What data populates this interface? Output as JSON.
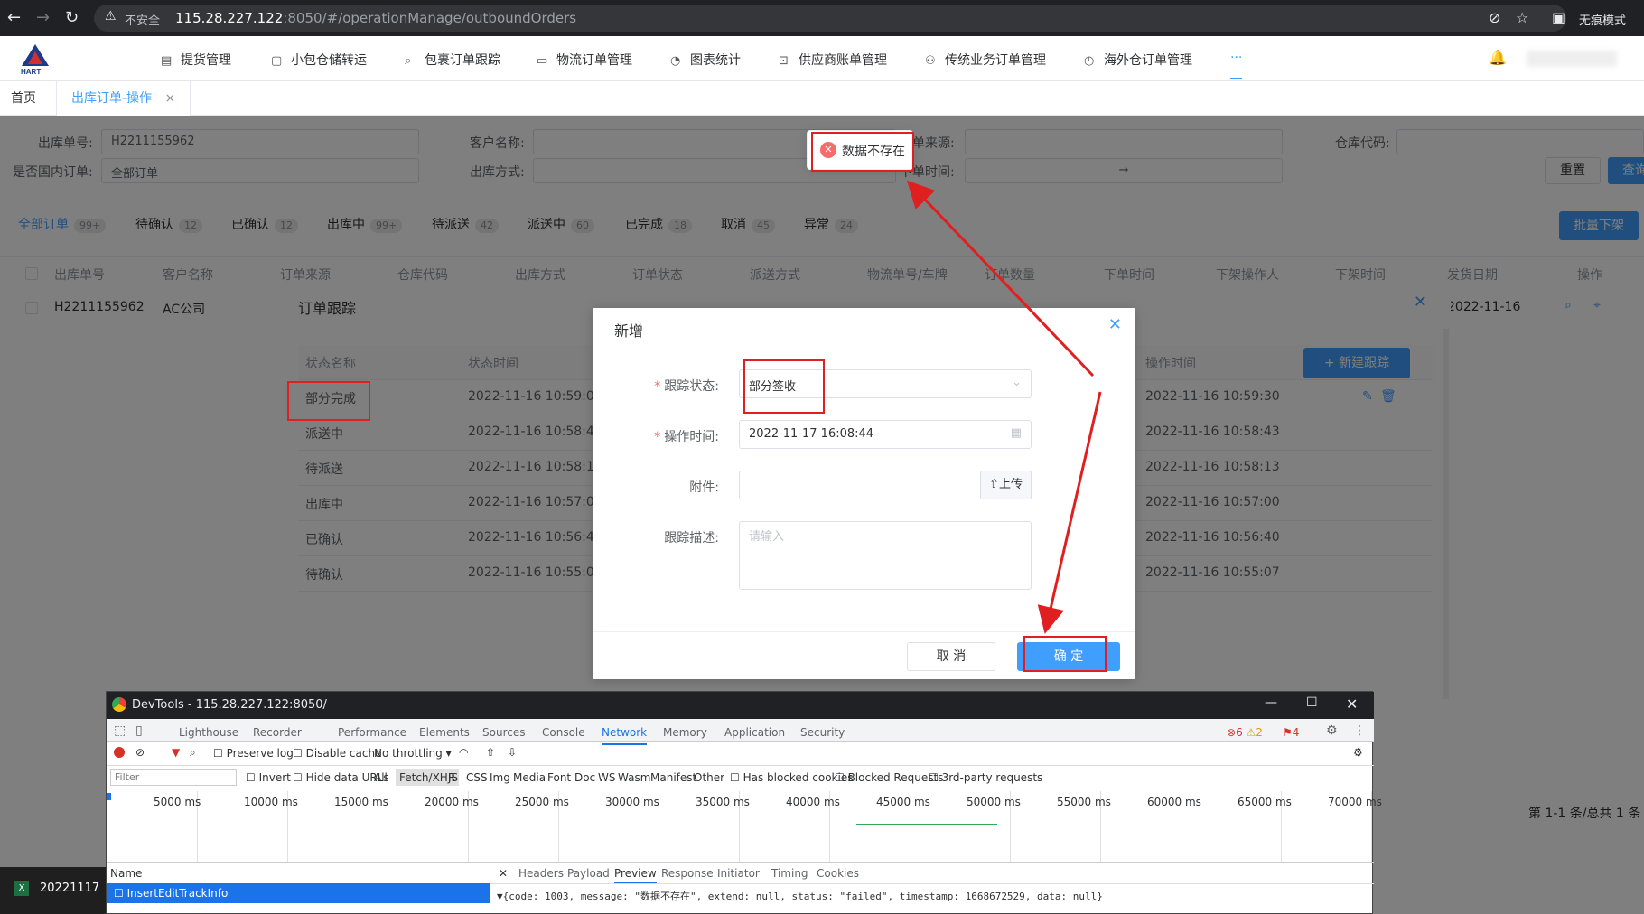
{
  "browser": {
    "not_secure": "不安全",
    "host": "115.28.227.122",
    "path": ":8050/#/operationManage/outboundOrders",
    "profile": "无痕模式"
  },
  "topnav": {
    "items": [
      {
        "label": "提货管理",
        "icon": "box-icon"
      },
      {
        "label": "小包仓储转运",
        "icon": "warehouse-icon"
      },
      {
        "label": "包裹订单跟踪",
        "icon": "search-icon"
      },
      {
        "label": "物流订单管理",
        "icon": "folder-icon"
      },
      {
        "label": "图表统计",
        "icon": "chart-icon"
      },
      {
        "label": "供应商账单管理",
        "icon": "bill-icon"
      },
      {
        "label": "传统业务订单管理",
        "icon": "org-icon"
      },
      {
        "label": "海外仓订单管理",
        "icon": "dashboard-icon"
      }
    ],
    "more": "···"
  },
  "tabs": {
    "home": "首页",
    "active": "出库订单-操作",
    "close": "×"
  },
  "filters": {
    "order_no_label": "出库单号:",
    "order_no_value": "H2211155962",
    "customer_label": "客户名称:",
    "source_label": "订单来源:",
    "warehouse_label": "仓库代码:",
    "domestic_label": "是否国内订单:",
    "domestic_value": "全部订单",
    "method_label": "出库方式:",
    "time_label": "下单时间:",
    "time_sep": "→",
    "reset": "重置",
    "search": "查询"
  },
  "status_tabs": [
    {
      "label": "全部订单",
      "count": "99+"
    },
    {
      "label": "待确认",
      "count": "12"
    },
    {
      "label": "已确认",
      "count": "12"
    },
    {
      "label": "出库中",
      "count": "99+"
    },
    {
      "label": "待派送",
      "count": "42"
    },
    {
      "label": "派送中",
      "count": "60"
    },
    {
      "label": "已完成",
      "count": "18"
    },
    {
      "label": "取消",
      "count": "45"
    },
    {
      "label": "异常",
      "count": "24"
    }
  ],
  "batch_button": "批量下架",
  "table": {
    "headers": [
      "出库单号",
      "客户名称",
      "订单来源",
      "仓库代码",
      "出库方式",
      "订单状态",
      "派送方式",
      "物流单号/车牌",
      "订单数量",
      "下单时间",
      "下架操作人",
      "下架时间",
      "发货日期",
      "操作"
    ],
    "row": {
      "order_no": "H2211155962",
      "customer": "AC公司",
      "ship_date": "2022-11-16"
    }
  },
  "pagination": "第 1-1 条/总共 1 条",
  "tracking_dialog": {
    "title": "订单跟踪",
    "col_status": "状态名称",
    "col_time": "状态时间",
    "col_op_time": "操作时间",
    "new_button": "+ 新建跟踪",
    "rows": [
      {
        "status": "部分完成",
        "time": "2022-11-16 10:59:06",
        "op_time": "2022-11-16 10:59:30"
      },
      {
        "status": "派送中",
        "time": "2022-11-16 10:58:43",
        "op_time": "2022-11-16 10:58:43"
      },
      {
        "status": "待派送",
        "time": "2022-11-16 10:58:13",
        "op_time": "2022-11-16 10:58:13"
      },
      {
        "status": "出库中",
        "time": "2022-11-16 10:57:00",
        "op_time": "2022-11-16 10:57:00"
      },
      {
        "status": "已确认",
        "time": "2022-11-16 10:56:40",
        "op_time": "2022-11-16 10:56:40"
      },
      {
        "status": "待确认",
        "time": "2022-11-16 10:55:07",
        "op_time": "2022-11-16 10:55:07"
      }
    ]
  },
  "add_dialog": {
    "title": "新增",
    "status_label": "跟踪状态:",
    "status_value": "部分签收",
    "time_label": "操作时间:",
    "time_value": "2022-11-17 16:08:44",
    "attach_label": "附件:",
    "upload": "上传",
    "desc_label": "跟踪描述:",
    "desc_placeholder": "请输入",
    "cancel": "取 消",
    "confirm": "确 定"
  },
  "toast": {
    "message": "数据不存在"
  },
  "devtools": {
    "title": "DevTools - 115.28.227.122:8050/",
    "tabs": [
      "Lighthouse",
      "Recorder",
      "Performance",
      "Elements",
      "Sources",
      "Console",
      "Network",
      "Memory",
      "Application",
      "Security"
    ],
    "active_tab": "Network",
    "errors": "6",
    "warnings": "2",
    "issues": "4",
    "preserve_log": "Preserve log",
    "disable_cache": "Disable cache",
    "throttling": "No throttling",
    "filter_placeholder": "Filter",
    "filter_opts": [
      "Invert",
      "Hide data URLs",
      "All",
      "Fetch/XHR",
      "JS",
      "CSS",
      "Img",
      "Media",
      "Font",
      "Doc",
      "WS",
      "Wasm",
      "Manifest",
      "Other",
      "Has blocked cookies",
      "Blocked Requests",
      "3rd-party requests"
    ],
    "ticks": [
      "5000 ms",
      "10000 ms",
      "15000 ms",
      "20000 ms",
      "25000 ms",
      "30000 ms",
      "35000 ms",
      "40000 ms",
      "45000 ms",
      "50000 ms",
      "55000 ms",
      "60000 ms",
      "65000 ms",
      "70000 ms"
    ],
    "name_header": "Name",
    "request": "InsertEditTrackInfo",
    "detail_tabs": [
      "Headers",
      "Payload",
      "Preview",
      "Response",
      "Initiator",
      "Timing",
      "Cookies"
    ],
    "active_detail": "Preview",
    "preview": "▼{code: 1003, message: \"数据不存在\", extend: null, status: \"failed\", timestamp: 1668672529, data: null}"
  },
  "taskbar": {
    "file": "20221117"
  }
}
